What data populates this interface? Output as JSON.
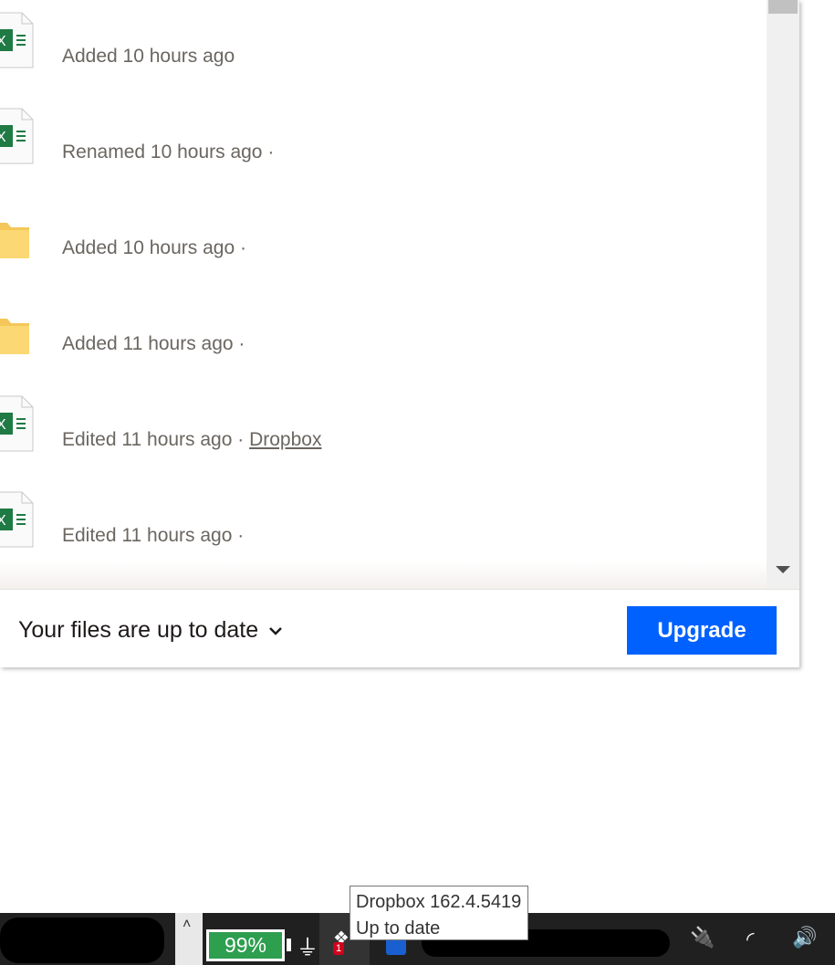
{
  "activity": [
    {
      "icon": "excel-file-icon",
      "text": "Added 10 hours ago",
      "link": ""
    },
    {
      "icon": "excel-file-icon",
      "text": "Renamed 10 hours ago ·",
      "link": ""
    },
    {
      "icon": "folder-icon",
      "text": "Added 10 hours ago ·",
      "link": ""
    },
    {
      "icon": "folder-icon",
      "text": "Added 11 hours ago ·",
      "link": ""
    },
    {
      "icon": "excel-file-icon",
      "text": "Edited 11 hours ago · ",
      "link": "Dropbox"
    },
    {
      "icon": "excel-file-icon",
      "text": "Edited 11 hours ago ·",
      "link": ""
    }
  ],
  "footer": {
    "status": "Your files are up to date",
    "upgrade": "Upgrade"
  },
  "tooltip": {
    "line1": "Dropbox 162.4.5419",
    "line2": "Up to date"
  },
  "taskbar": {
    "battery": "99%",
    "dropbox_badge": "1"
  },
  "colors": {
    "accent": "#0061fe",
    "battery": "#2e9e4f"
  }
}
